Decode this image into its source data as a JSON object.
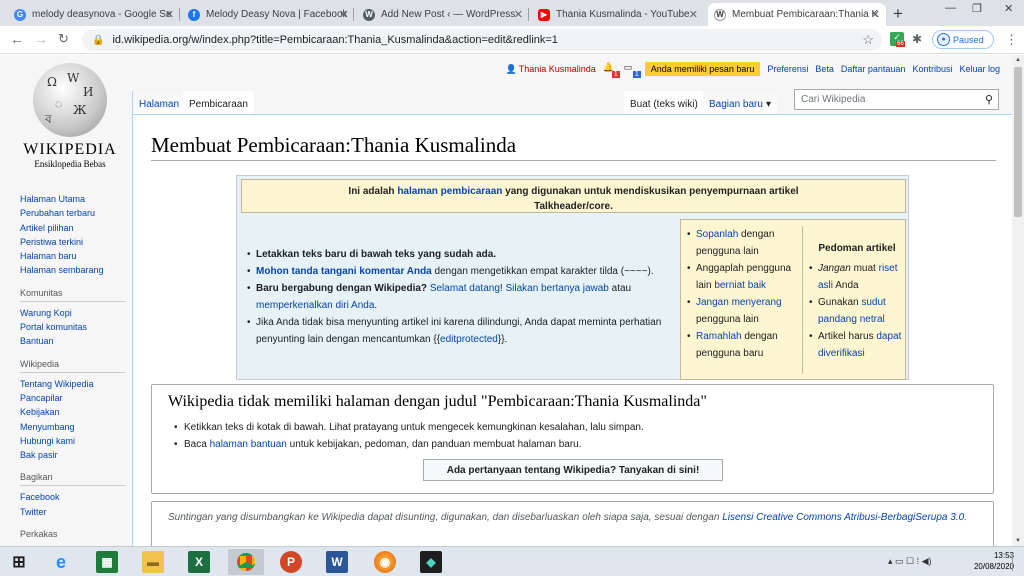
{
  "browser": {
    "tabs": [
      {
        "title": "melody deasynova - Google Se",
        "icon": "google-icon",
        "color": "#4285f4",
        "glyph": "G"
      },
      {
        "title": "Melody Deasy Nova | Facebook",
        "icon": "facebook-icon",
        "color": "#1877f2",
        "glyph": "f"
      },
      {
        "title": "Add New Post ‹ — WordPress",
        "icon": "wordpress-icon",
        "color": "#555d66",
        "glyph": "W"
      },
      {
        "title": "Thania Kusmalinda - YouTube",
        "icon": "youtube-icon",
        "color": "#ff0000",
        "glyph": "▶"
      },
      {
        "title": "Membuat Pembicaraan:Thania K",
        "icon": "wikipedia-icon",
        "color": "#333333",
        "glyph": "W"
      }
    ],
    "url": "id.wikipedia.org/w/index.php?title=Pembicaraan:Thania_Kusmalinda&action=edit&redlink=1",
    "paused_label": "Paused",
    "ext_badge": "66"
  },
  "personal": {
    "user": "Thania Kusmalinda",
    "alert_count": "1",
    "notice_count": "1",
    "message_banner": "Anda memiliki pesan baru",
    "links": [
      "Preferensi",
      "Beta",
      "Daftar pantauan",
      "Kontribusi",
      "Keluar log"
    ]
  },
  "logo": {
    "wordmark": "Wikipedia",
    "tagline": "Ensiklopedia Bebas"
  },
  "sidebar": {
    "main": [
      "Halaman Utama",
      "Perubahan terbaru",
      "Artikel pilihan",
      "Peristiwa terkini",
      "Halaman baru",
      "Halaman sembarang"
    ],
    "community_head": "Komunitas",
    "community": [
      "Warung Kopi",
      "Portal komunitas",
      "Bantuan"
    ],
    "wikipedia_head": "Wikipedia",
    "wikipedia": [
      "Tentang Wikipedia",
      "Pancapilar",
      "Kebijakan",
      "Menyumbang",
      "Hubungi kami",
      "Bak pasir"
    ],
    "share_head": "Bagikan",
    "share": [
      "Facebook",
      "Twitter"
    ],
    "tools_head": "Perkakas"
  },
  "page_tabs": {
    "article": "Halaman",
    "talk": "Pembicaraan",
    "create": "Buat (teks wiki)",
    "section": "Bagian baru"
  },
  "search": {
    "placeholder": "Cari Wikipedia"
  },
  "title": "Membuat Pembicaraan:Thania Kusmalinda",
  "talkheader": {
    "top_pre": "Ini adalah ",
    "top_link": "halaman pembicaraan",
    "top_post": " yang digunakan untuk mendiskusikan penyempurnaan artikel",
    "top_line2": "Talkheader/core.",
    "items": [
      {
        "a": "Letakkan teks baru di bawah teks yang sudah ada.",
        "b": "",
        "c": "",
        "d": "",
        "e": ""
      },
      {
        "a": "Mohon tanda tangani komentar Anda",
        "b": " dengan mengetikkan empat karakter tilda (~~~~).",
        "c": "",
        "d": "",
        "e": ""
      },
      {
        "a": "Baru bergabung dengan Wikipedia?",
        "b": " ",
        "c": "Selamat datang",
        "d": "! ",
        "e": "Silakan bertanya jawab"
      }
    ],
    "item3_tail": " atau ",
    "item3_link2": "memperkenalkan diri Anda",
    "item3_end": ".",
    "item4_pre": "Jika Anda tidak bisa menyunting artikel ini karena dilindungi, Anda dapat meminta perhatian penyunting lain dengan mencantumkan {{",
    "item4_link": "editprotected",
    "item4_post": "}}.",
    "right1": [
      {
        "link": "Sopanlah",
        "text": " dengan pengguna lain"
      },
      {
        "text": "Anggaplah pengguna lain ",
        "link": "berniat baik"
      },
      {
        "link": "Jangan menyerang",
        "text": " pengguna lain"
      },
      {
        "link": "Ramahlah",
        "text": " dengan pengguna baru"
      }
    ],
    "guide_head": "Pedoman artikel",
    "right2": [
      {
        "pre": "",
        "em": "Jangan",
        "mid": " muat ",
        "link": "riset asli",
        "post": " Anda"
      },
      {
        "pre": "Gunakan ",
        "em": "",
        "mid": "",
        "link": "sudut pandang netral",
        "post": ""
      },
      {
        "pre": "Artikel harus ",
        "em": "",
        "mid": "",
        "link": "dapat diverifikasi",
        "post": ""
      }
    ]
  },
  "notice": {
    "heading": "Wikipedia tidak memiliki halaman dengan judul \"Pembicaraan:Thania Kusmalinda\"",
    "line1": "Ketikkan teks di kotak di bawah. Lihat pratayang untuk mengecek kemungkinan kesalahan, lalu simpan.",
    "line2_pre": "Baca ",
    "line2_link": "halaman bantuan",
    "line2_post": " untuk kebijakan, pedoman, dan panduan membuat halaman baru.",
    "button": "Ada pertanyaan tentang Wikipedia? Tanyakan di sini!"
  },
  "license": {
    "text": "Suntingan yang disumbangkan ke Wikipedia dapat disunting, digunakan, dan disebarluaskan oleh siapa saja, sesuai dengan ",
    "link": "Lisensi Creative Commons Atribusi-BerbagiSerupa 3.0",
    "end": "."
  },
  "taskbar": {
    "time": "13:53",
    "date": "20/08/2020"
  },
  "colors": {
    "link": "#0645ad",
    "redlink": "#ba0000",
    "message": "#ffcc33",
    "taskbar": "#dfe6ee"
  }
}
